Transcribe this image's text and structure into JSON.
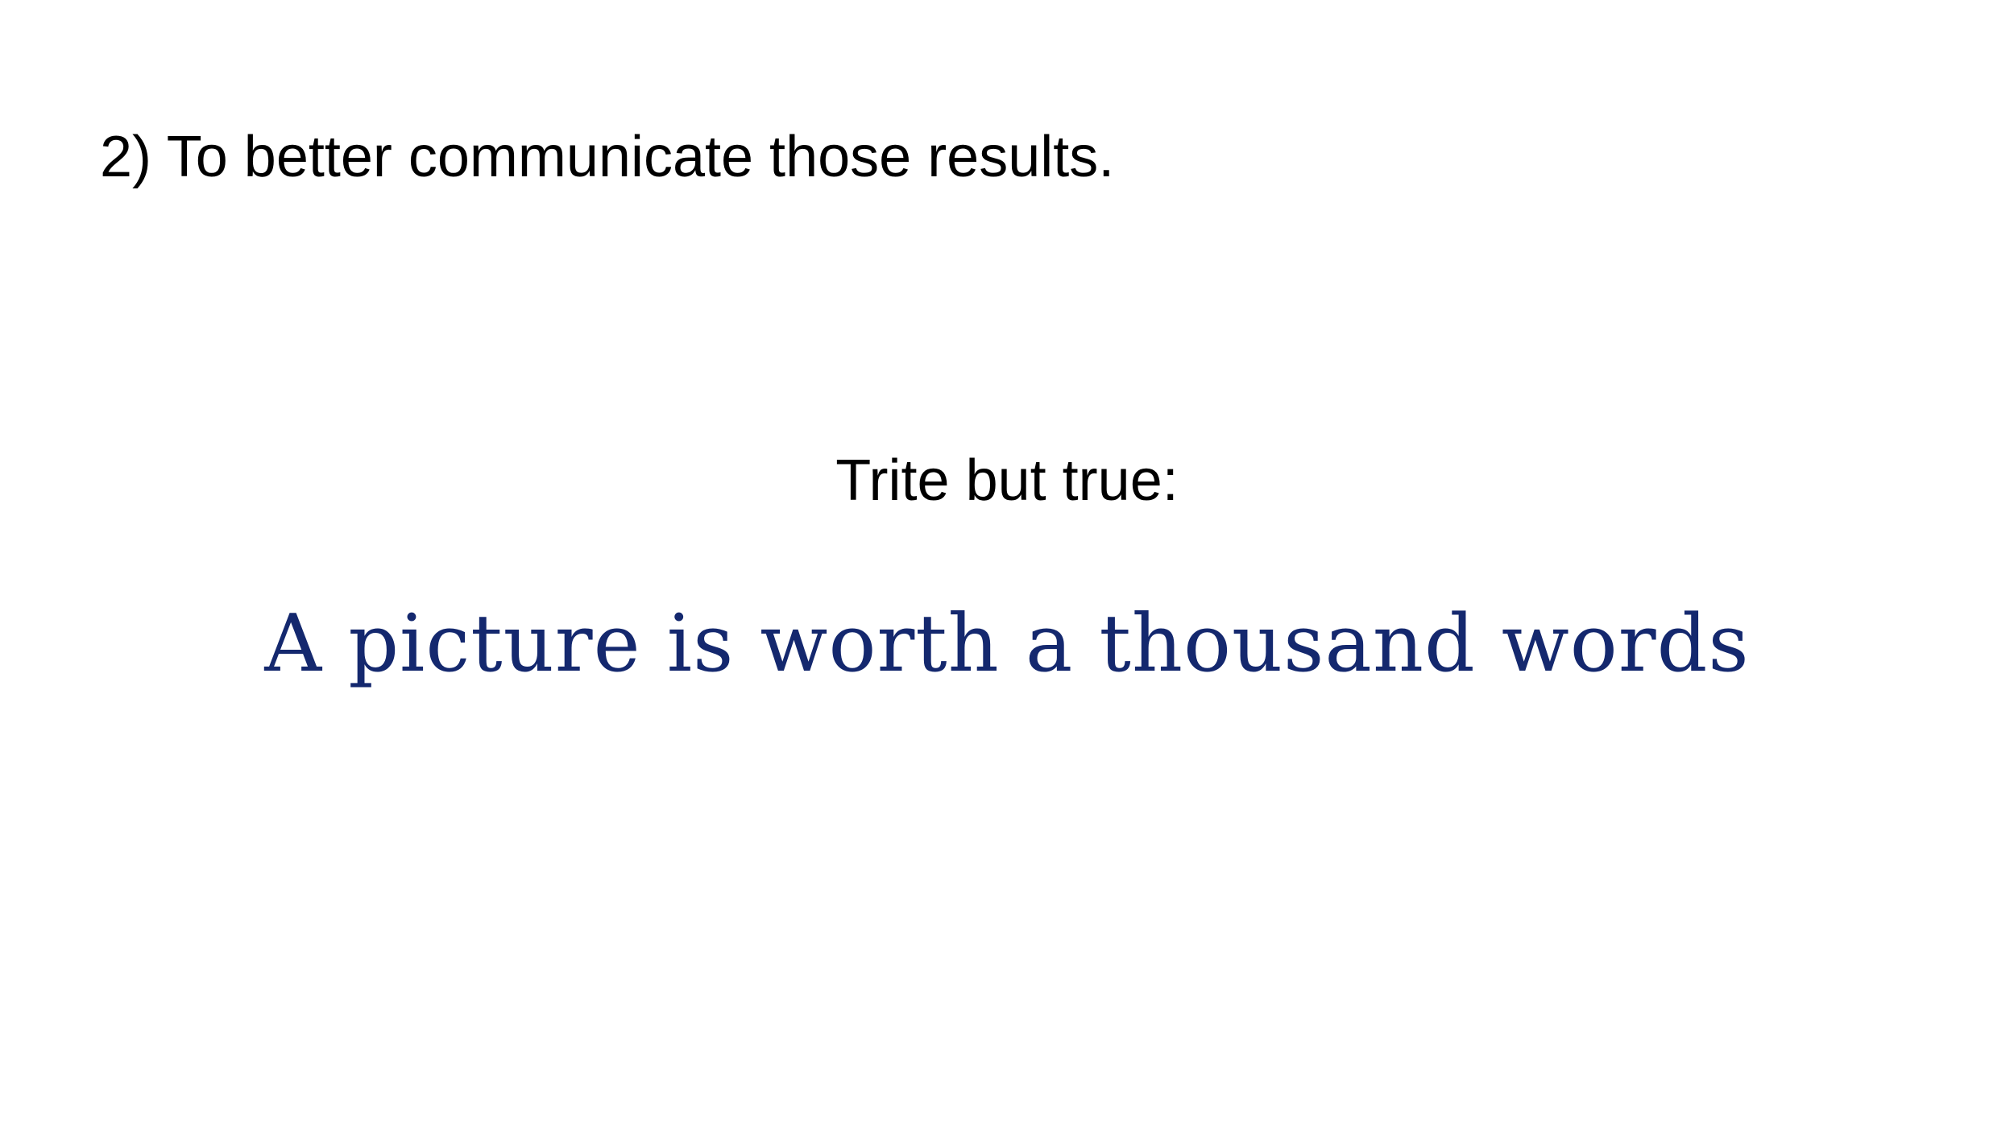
{
  "slide": {
    "heading": "2) To better communicate those results.",
    "lead": "Trite but true:",
    "quote": "A picture is worth a thousand words"
  },
  "colors": {
    "background": "#ffffff",
    "text": "#000000",
    "quote": "#14286e"
  }
}
